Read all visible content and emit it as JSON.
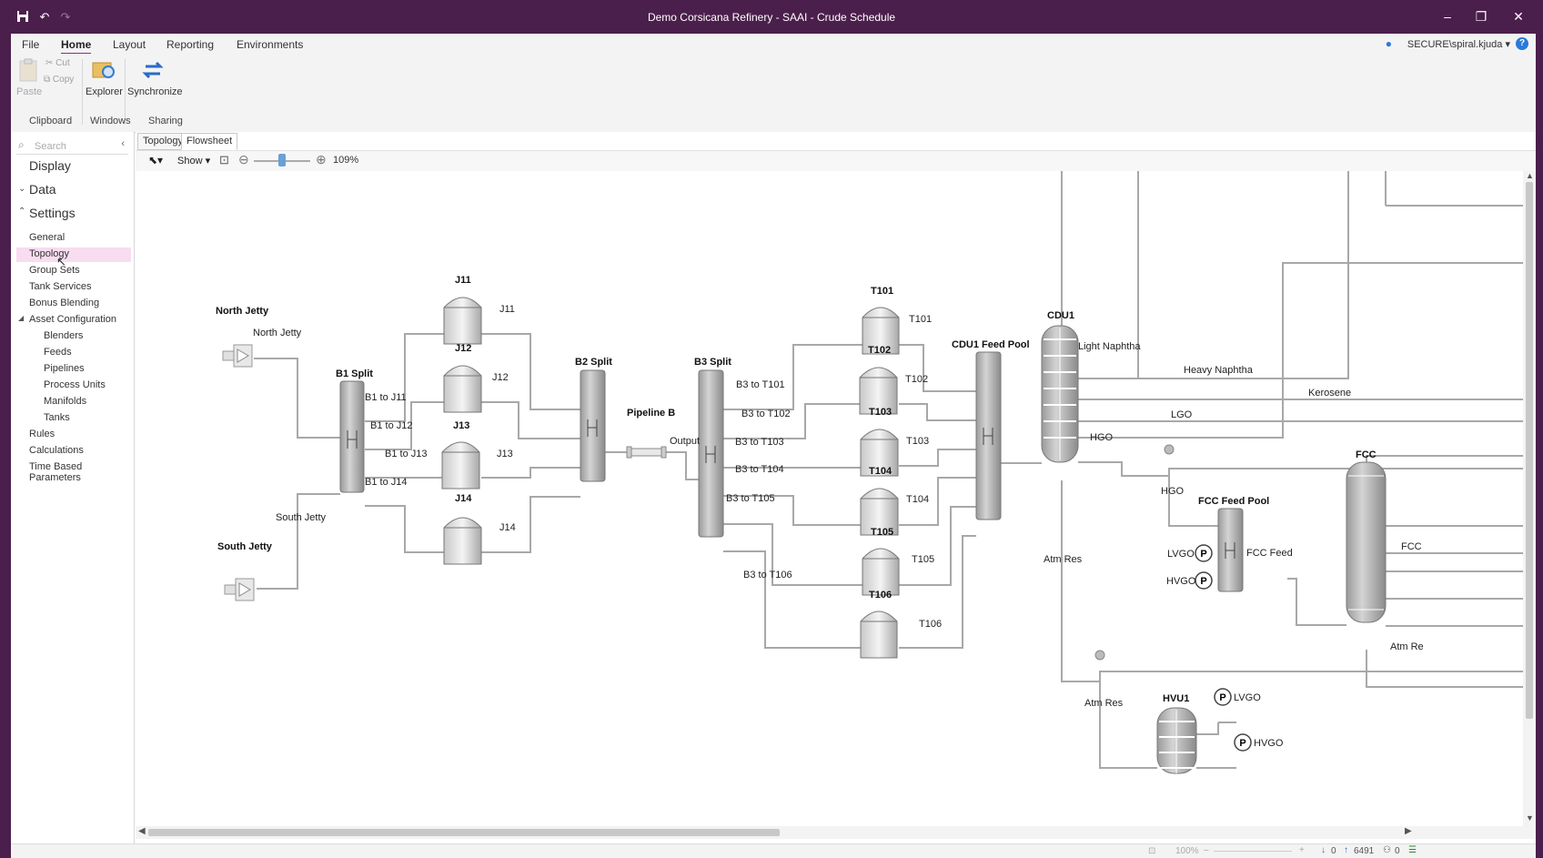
{
  "window": {
    "title": "Demo Corsicana Refinery - SAAI - Crude Schedule"
  },
  "menu": {
    "items": [
      "File",
      "Home",
      "Layout",
      "Reporting",
      "Environments"
    ],
    "active": "Home",
    "user": "SECURE\\spiral.kjuda",
    "help": "?"
  },
  "ribbon": {
    "paste": "Paste",
    "cut": "Cut",
    "copy": "Copy",
    "explorer": "Explorer",
    "synchronize": "Synchronize",
    "groups": [
      "Clipboard",
      "Windows",
      "Sharing"
    ]
  },
  "leftpane": {
    "search_placeholder": "Search",
    "display": "Display",
    "data": "Data",
    "settings": "Settings",
    "settings_items": [
      "General",
      "Topology",
      "Group Sets",
      "Tank Services",
      "Bonus Blending"
    ],
    "asset_configuration": "Asset Configuration",
    "asset_items": [
      "Blenders",
      "Feeds",
      "Pipelines",
      "Process Units",
      "Manifolds",
      "Tanks"
    ],
    "bottom_items": [
      "Rules",
      "Calculations",
      "Time Based Parameters"
    ]
  },
  "doc": {
    "tabs": [
      "Topology",
      "Flowsheet"
    ],
    "active_tab": "Flowsheet",
    "show": "Show",
    "zoom": "109%"
  },
  "status": {
    "zoom": "100%",
    "down_count": "0",
    "up_count": "6491",
    "users": "0"
  },
  "flowsheet": {
    "nodes": {
      "north_jetty": "North Jetty",
      "south_jetty": "South Jetty",
      "b1_split": "B1 Split",
      "b2_split": "B2 Split",
      "b3_split": "B3 Split",
      "pipeline_b": "Pipeline B",
      "j11": "J11",
      "j12": "J12",
      "j13": "J13",
      "j14": "J14",
      "t101": "T101",
      "t102": "T102",
      "t103": "T103",
      "t104": "T104",
      "t105": "T105",
      "t106": "T106",
      "cdu1_feed_pool": "CDU1 Feed Pool",
      "cdu1": "CDU1",
      "fcc_feed_pool": "FCC Feed Pool",
      "fcc": "FCC",
      "hvu1": "HVU1",
      "pump": "P"
    },
    "streams": {
      "north_jetty": "North Jetty",
      "south_jetty": "South Jetty",
      "b1_j11": "B1 to J11",
      "b1_j12": "B1 to J12",
      "b1_j13": "B1 to J13",
      "b1_j14": "B1 to J14",
      "j11": "J11",
      "j12": "J12",
      "j13": "J13",
      "j14": "J14",
      "output": "Output",
      "b3_t101": "B3 to T101",
      "b3_t102": "B3 to T102",
      "b3_t103": "B3 to T103",
      "b3_t104": "B3 to T104",
      "b3_t105": "B3 to T105",
      "b3_t106": "B3 to T106",
      "t101": "T101",
      "t102": "T102",
      "t103": "T103",
      "t104": "T104",
      "t105": "T105",
      "t106": "T106",
      "light_naphtha": "Light Naphtha",
      "heavy_naphtha": "Heavy Naphtha",
      "kerosene": "Kerosene",
      "lgo": "LGO",
      "hgo": "HGO",
      "hgo2": "HGO",
      "atm_res": "Atm Res",
      "atm_res2": "Atm Res",
      "atm_res3": "Atm Re",
      "lvgo": "LVGO",
      "hvgo": "HVGO",
      "fcc_feed": "FCC Feed",
      "fcc_out": "FCC",
      "lvgo2": "LVGO",
      "hvgo2": "HVGO"
    }
  },
  "colors": {
    "titlebar": "#4b1f4b",
    "accent": "#7a3a7a",
    "selected": "#f8dcf0",
    "line": "#a8a8a8",
    "equip": "#9a9a9a"
  }
}
